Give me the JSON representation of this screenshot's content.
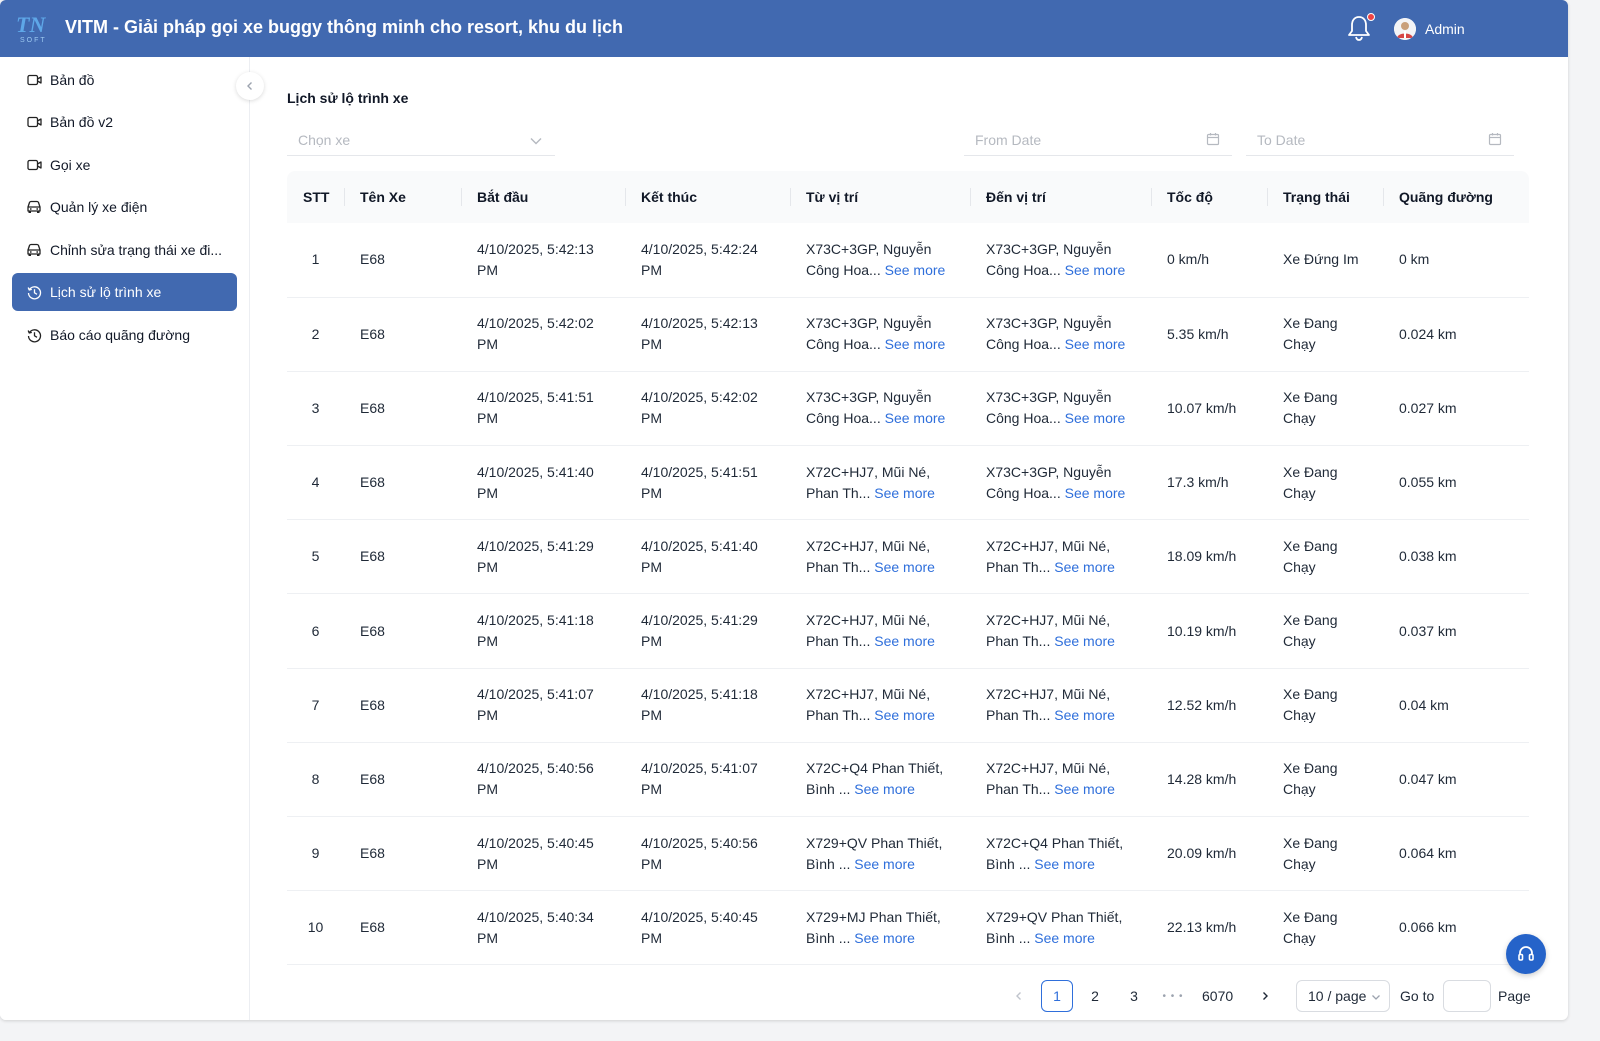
{
  "header": {
    "title": "VITM - Giải pháp gọi xe buggy thông minh cho resort, khu du lịch",
    "logo_text": "TN SOFT",
    "user_name": "Admin"
  },
  "sidebar": {
    "items": [
      {
        "label": "Bản đồ",
        "icon": "video-icon"
      },
      {
        "label": "Bản đồ v2",
        "icon": "video-icon"
      },
      {
        "label": "Gọi xe",
        "icon": "video-icon"
      },
      {
        "label": "Quản lý xe điện",
        "icon": "car-icon"
      },
      {
        "label": "Chỉnh sửa trạng thái xe đi...",
        "icon": "car-icon"
      },
      {
        "label": "Lịch sử lộ trình xe",
        "icon": "history-icon",
        "active": true
      },
      {
        "label": "Báo cáo quãng đường",
        "icon": "history-icon"
      }
    ]
  },
  "page": {
    "title": "Lịch sử lộ trình xe",
    "vehicle_select_placeholder": "Chọn xe",
    "from_date_placeholder": "From Date",
    "to_date_placeholder": "To Date"
  },
  "table": {
    "columns": [
      "STT",
      "Tên Xe",
      "Bắt đầu",
      "Kết thúc",
      "Từ vị trí",
      "Đến vị trí",
      "Tốc độ",
      "Trạng thái",
      "Quãng đường"
    ],
    "see_more_label": "See more",
    "rows": [
      {
        "stt": "1",
        "name": "E68",
        "start": "4/10/2025, 5:42:13 PM",
        "end": "4/10/2025, 5:42:24 PM",
        "from": "X73C+3GP, Nguyễn Công Hoa...",
        "to": "X73C+3GP, Nguyễn Công Hoa...",
        "speed": "0 km/h",
        "status": "Xe Đứng Im",
        "distance": "0 km"
      },
      {
        "stt": "2",
        "name": "E68",
        "start": "4/10/2025, 5:42:02 PM",
        "end": "4/10/2025, 5:42:13 PM",
        "from": "X73C+3GP, Nguyễn Công Hoa...",
        "to": "X73C+3GP, Nguyễn Công Hoa...",
        "speed": "5.35 km/h",
        "status": "Xe Đang Chạy",
        "distance": "0.024 km"
      },
      {
        "stt": "3",
        "name": "E68",
        "start": "4/10/2025, 5:41:51 PM",
        "end": "4/10/2025, 5:42:02 PM",
        "from": "X73C+3GP, Nguyễn Công Hoa...",
        "to": "X73C+3GP, Nguyễn Công Hoa...",
        "speed": "10.07 km/h",
        "status": "Xe Đang Chạy",
        "distance": "0.027 km"
      },
      {
        "stt": "4",
        "name": "E68",
        "start": "4/10/2025, 5:41:40 PM",
        "end": "4/10/2025, 5:41:51 PM",
        "from": "X72C+HJ7, Mũi Né, Phan Th...",
        "to": "X73C+3GP, Nguyễn Công Hoa...",
        "speed": "17.3 km/h",
        "status": "Xe Đang Chạy",
        "distance": "0.055 km"
      },
      {
        "stt": "5",
        "name": "E68",
        "start": "4/10/2025, 5:41:29 PM",
        "end": "4/10/2025, 5:41:40 PM",
        "from": "X72C+HJ7, Mũi Né, Phan Th...",
        "to": "X72C+HJ7, Mũi Né, Phan Th...",
        "speed": "18.09 km/h",
        "status": "Xe Đang Chạy",
        "distance": "0.038 km"
      },
      {
        "stt": "6",
        "name": "E68",
        "start": "4/10/2025, 5:41:18 PM",
        "end": "4/10/2025, 5:41:29 PM",
        "from": "X72C+HJ7, Mũi Né, Phan Th...",
        "to": "X72C+HJ7, Mũi Né, Phan Th...",
        "speed": "10.19 km/h",
        "status": "Xe Đang Chạy",
        "distance": "0.037 km"
      },
      {
        "stt": "7",
        "name": "E68",
        "start": "4/10/2025, 5:41:07 PM",
        "end": "4/10/2025, 5:41:18 PM",
        "from": "X72C+HJ7, Mũi Né, Phan Th...",
        "to": "X72C+HJ7, Mũi Né, Phan Th...",
        "speed": "12.52 km/h",
        "status": "Xe Đang Chạy",
        "distance": "0.04 km"
      },
      {
        "stt": "8",
        "name": "E68",
        "start": "4/10/2025, 5:40:56 PM",
        "end": "4/10/2025, 5:41:07 PM",
        "from": "X72C+Q4 Phan Thiết, Bình ...",
        "to": "X72C+HJ7, Mũi Né, Phan Th...",
        "speed": "14.28 km/h",
        "status": "Xe Đang Chạy",
        "distance": "0.047 km"
      },
      {
        "stt": "9",
        "name": "E68",
        "start": "4/10/2025, 5:40:45 PM",
        "end": "4/10/2025, 5:40:56 PM",
        "from": "X729+QV Phan Thiết, Bình ...",
        "to": "X72C+Q4 Phan Thiết, Bình ...",
        "speed": "20.09 km/h",
        "status": "Xe Đang Chạy",
        "distance": "0.064 km"
      },
      {
        "stt": "10",
        "name": "E68",
        "start": "4/10/2025, 5:40:34 PM",
        "end": "4/10/2025, 5:40:45 PM",
        "from": "X729+MJ Phan Thiết, Bình ...",
        "to": "X729+QV Phan Thiết, Bình ...",
        "speed": "22.13 km/h",
        "status": "Xe Đang Chạy",
        "distance": "0.066 km"
      }
    ]
  },
  "pagination": {
    "pages": [
      "1",
      "2",
      "3"
    ],
    "current": "1",
    "ellipsis": "• • •",
    "last_page": "6070",
    "page_size": "10 / page",
    "goto_label": "Go to",
    "page_label": "Page"
  },
  "colors": {
    "header_bg": "#4169b0",
    "active_nav_bg": "#4169b0",
    "link": "#2f6fdb",
    "support_button": "#2563c9"
  }
}
